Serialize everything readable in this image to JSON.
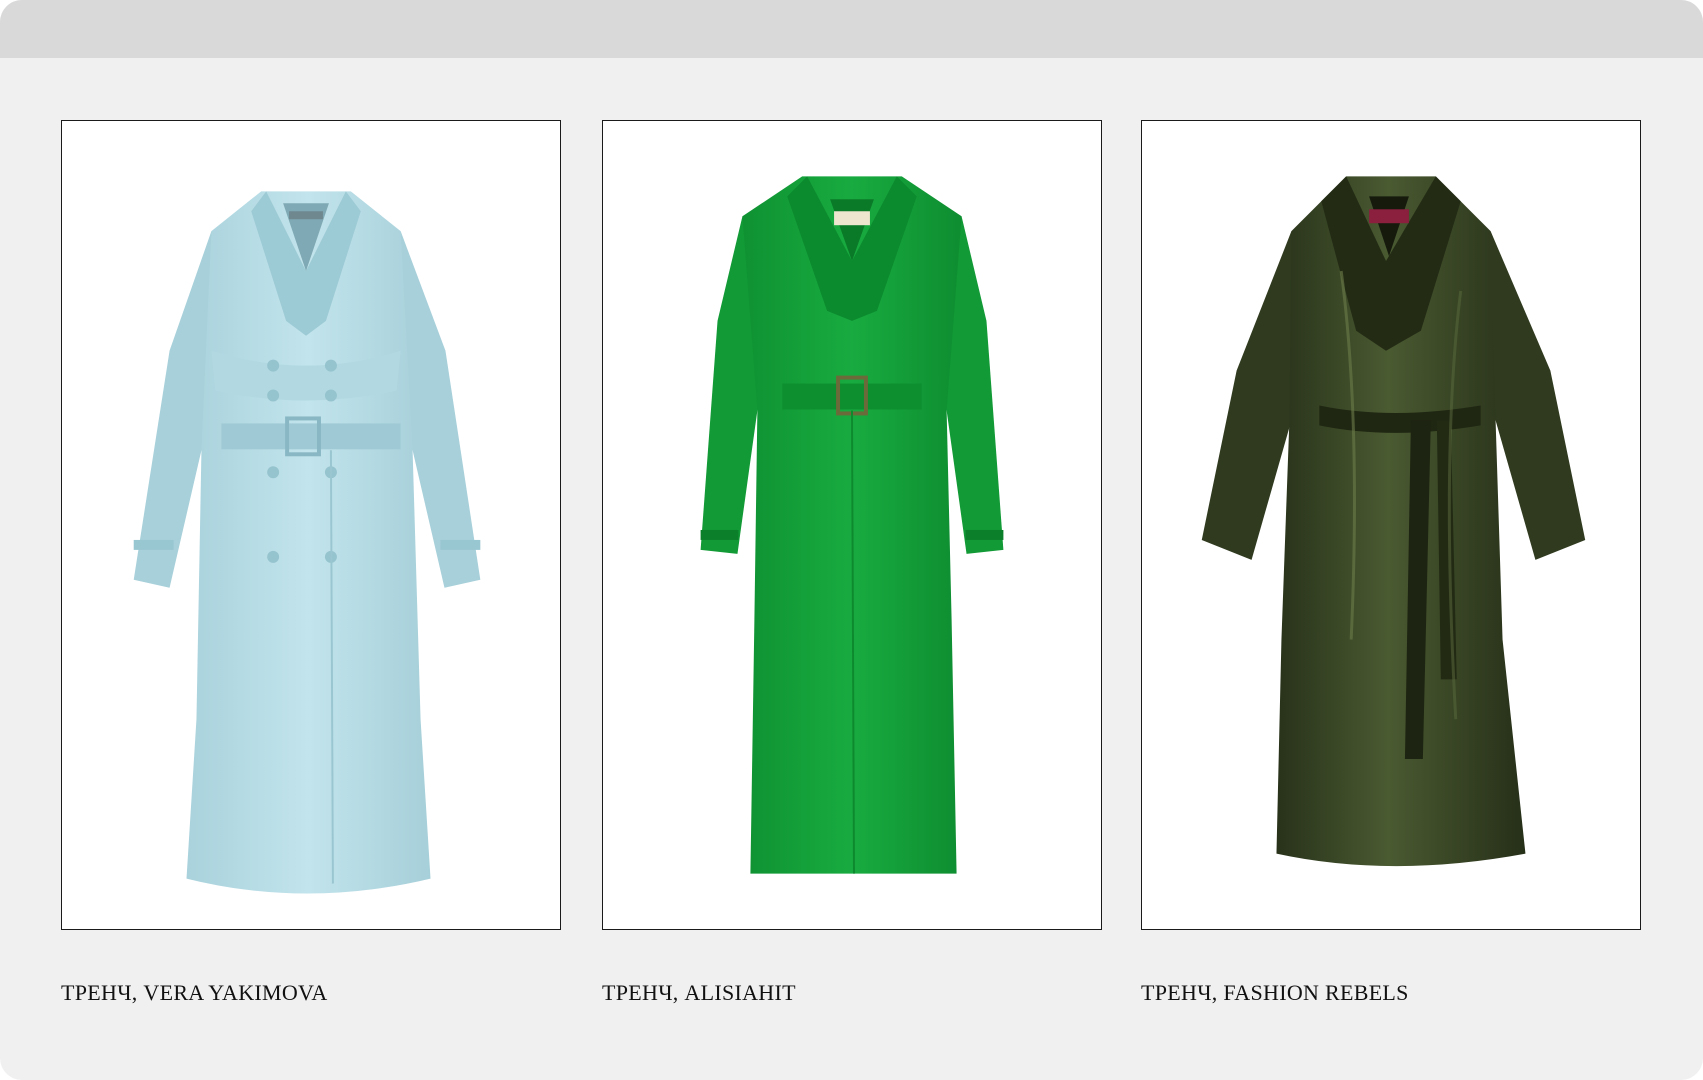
{
  "products": [
    {
      "caption": "ТРЕНЧ, VERA YAKIMOVA",
      "image_icon": "trench-coat-light-blue",
      "color": "#b9dfe8"
    },
    {
      "caption": "ТРЕНЧ, ALISIAHIT",
      "image_icon": "trench-coat-green",
      "color": "#13a33b"
    },
    {
      "caption": "ТРЕНЧ, FASHION REBELS",
      "image_icon": "trench-coat-dark-olive",
      "color": "#2f3a1e"
    }
  ]
}
